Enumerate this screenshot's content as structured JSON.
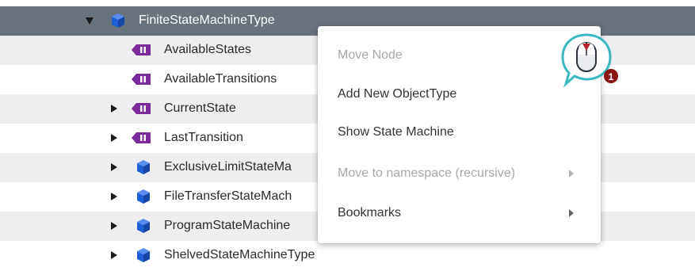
{
  "tree": {
    "rows": [
      {
        "label": "FiniteStateMachineType",
        "icon": "object-type-cube-icon",
        "expander": "open",
        "selected": true
      },
      {
        "label": "AvailableStates",
        "icon": "variable-icon",
        "expander": "none"
      },
      {
        "label": "AvailableTransitions",
        "icon": "variable-icon",
        "expander": "none"
      },
      {
        "label": "CurrentState",
        "icon": "variable-icon",
        "expander": "closed"
      },
      {
        "label": "LastTransition",
        "icon": "variable-icon",
        "expander": "closed"
      },
      {
        "label": "ExclusiveLimitStateMa",
        "icon": "object-type-cube-icon",
        "expander": "closed"
      },
      {
        "label": "FileTransferStateMach",
        "icon": "object-type-cube-icon",
        "expander": "closed"
      },
      {
        "label": "ProgramStateMachine",
        "icon": "object-type-cube-icon",
        "expander": "closed"
      },
      {
        "label": "ShelvedStateMachineType",
        "icon": "object-type-cube-icon",
        "expander": "closed"
      }
    ]
  },
  "context_menu": {
    "items": [
      {
        "label": "Move Node",
        "disabled": true,
        "submenu": false
      },
      {
        "label": "Add New ObjectType",
        "disabled": false,
        "submenu": false
      },
      {
        "label": "Show State Machine",
        "disabled": false,
        "submenu": false
      },
      {
        "label": "Move to namespace (recursive)",
        "disabled": true,
        "submenu": true
      },
      {
        "label": "Bookmarks",
        "disabled": false,
        "submenu": true
      }
    ]
  },
  "callout": {
    "icon": "right-mouse-click-icon",
    "step": "1"
  },
  "colors": {
    "selected_row": "#69737e",
    "alt_row": "#eeeef0",
    "cube_blue": "#1f5fd6",
    "variable_purple": "#7a2a9a",
    "callout_teal": "#3cb7bd",
    "mouse_red": "#b5202a",
    "step_badge": "#8b1414"
  }
}
